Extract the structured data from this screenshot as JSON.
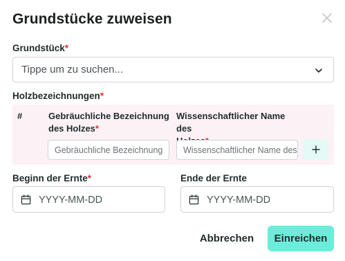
{
  "dialog": {
    "title": "Grundstücke zuweisen",
    "close_icon": "close-icon"
  },
  "plot_field": {
    "label": "Grundstück",
    "required_mark": "*",
    "placeholder": "Tippe um zu suchen...",
    "chevron_icon": "chevron-down-icon"
  },
  "wood": {
    "label": "Holzbezeichnungen",
    "required_mark": "*",
    "columns": {
      "index": "#",
      "common_line1": "Gebräuchliche Bezeichnung",
      "common_line2": "des Holzes",
      "scientific_line1": "Wissenschaftlicher Name des",
      "scientific_line2": "Holzes",
      "required_mark": "*"
    },
    "row": {
      "common_placeholder": "Gebräuchliche Bezeichnung",
      "scientific_placeholder": "Wissenschaftlicher Name des",
      "add_icon": "plus-icon"
    }
  },
  "harvest": {
    "start_label": "Beginn der Ernte",
    "start_required_mark": "*",
    "start_placeholder": "YYYY-MM-DD",
    "end_label": "Ende der Ernte",
    "end_placeholder": "YYYY-MM-DD",
    "calendar_icon": "calendar-icon"
  },
  "actions": {
    "cancel": "Abbrechen",
    "submit": "Einreichen"
  },
  "colors": {
    "accent": "#6cedd9",
    "add_button_bg": "#e3faf6",
    "table_bg": "#fcf1f5",
    "required": "#e03131"
  }
}
